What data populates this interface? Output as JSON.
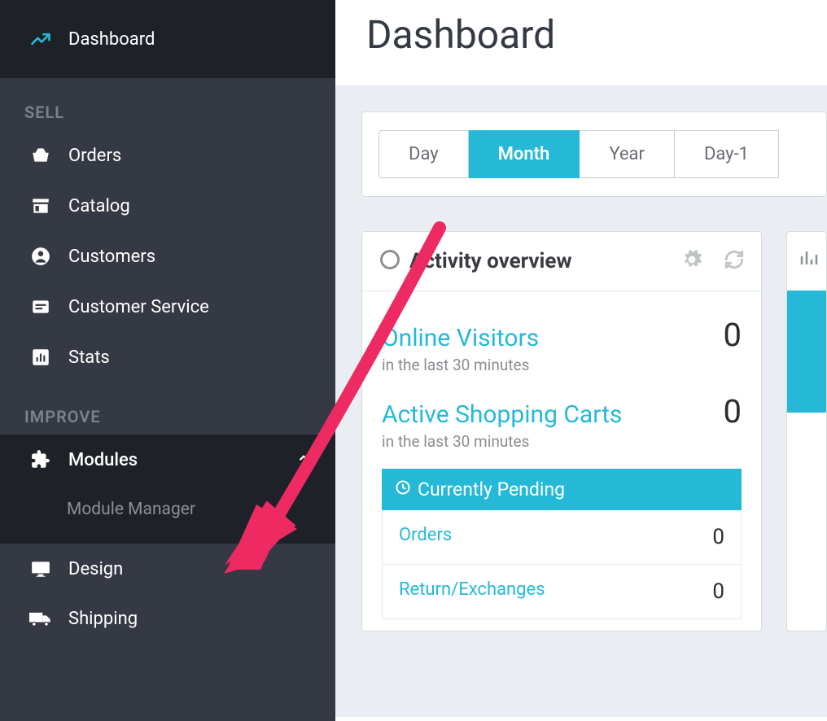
{
  "sidebar": {
    "dashboard": "Dashboard",
    "section_sell": "SELL",
    "orders": "Orders",
    "catalog": "Catalog",
    "customers": "Customers",
    "customer_service": "Customer Service",
    "stats": "Stats",
    "section_improve": "IMPROVE",
    "modules": "Modules",
    "module_manager": "Module Manager",
    "design": "Design",
    "shipping": "Shipping"
  },
  "page": {
    "title": "Dashboard"
  },
  "tabs": {
    "day": "Day",
    "month": "Month",
    "year": "Year",
    "day_minus1": "Day-1"
  },
  "activity": {
    "title": "Activity overview",
    "online_visitors_label": "Online Visitors",
    "online_visitors_value": "0",
    "online_visitors_sub": "in the last 30 minutes",
    "active_carts_label": "Active Shopping Carts",
    "active_carts_value": "0",
    "active_carts_sub": "in the last 30 minutes",
    "pending_header": "Currently Pending",
    "pending_orders_label": "Orders",
    "pending_orders_value": "0",
    "pending_returns_label": "Return/Exchanges",
    "pending_returns_value": "0"
  }
}
